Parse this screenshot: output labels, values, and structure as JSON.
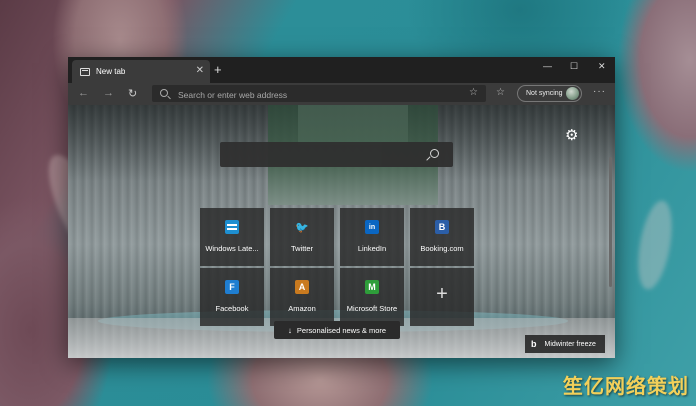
{
  "tab": {
    "title": "New tab"
  },
  "toolbar": {
    "address_placeholder": "Search or enter web address",
    "sync_label": "Not syncing"
  },
  "tiles": [
    {
      "label": "Windows Late...",
      "icon": "windows-latest-icon",
      "color": "#1e8fd1",
      "glyph": ""
    },
    {
      "label": "Twitter",
      "icon": "twitter-icon",
      "color": "#2a2a2a",
      "glyph": "🐦"
    },
    {
      "label": "LinkedIn",
      "icon": "linkedin-icon",
      "color": "#0a66c2",
      "glyph": "in"
    },
    {
      "label": "Booking.com",
      "icon": "booking-icon",
      "color": "#2b5ea7",
      "glyph": "B"
    },
    {
      "label": "Facebook",
      "icon": "facebook-icon",
      "color": "#1f7ed1",
      "glyph": "F"
    },
    {
      "label": "Amazon",
      "icon": "amazon-icon",
      "color": "#c97a1f",
      "glyph": "A"
    },
    {
      "label": "Microsoft Store",
      "icon": "microsoft-store-icon",
      "color": "#2e9d3a",
      "glyph": "M"
    },
    {
      "label": "",
      "icon": "add-site-icon",
      "color": "",
      "glyph": ""
    }
  ],
  "news_button": "Personalised news & more",
  "image_credit": {
    "brand": "b",
    "caption": "Midwinter freeze"
  },
  "watermark": "笙亿网络策划",
  "colors": {
    "accent": "#f2d05a",
    "frame": "#202020",
    "toolbar": "#3b3b3b"
  }
}
